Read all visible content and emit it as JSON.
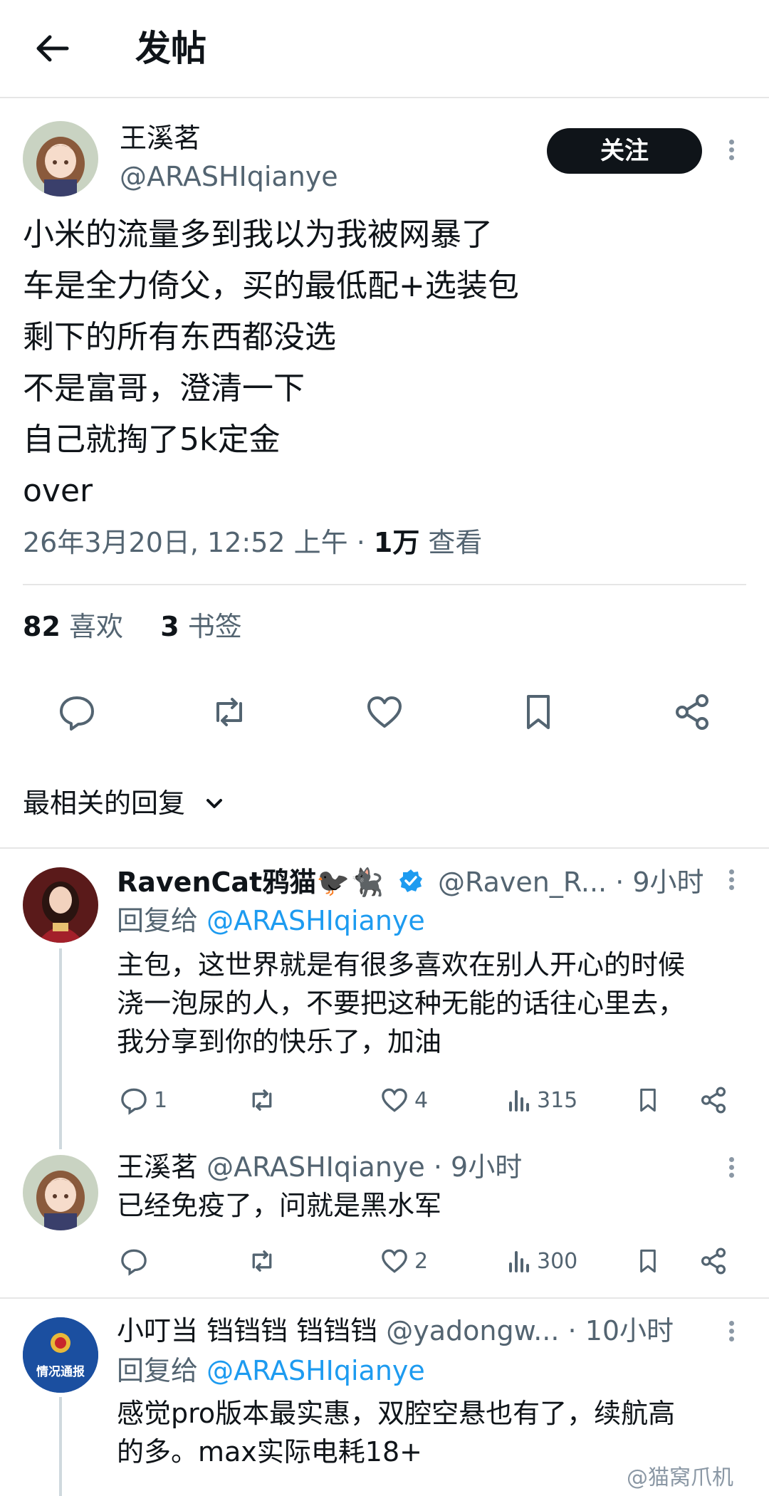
{
  "header": {
    "title": "发帖"
  },
  "post": {
    "author_name": "王溪茗",
    "author_handle": "@ARASHIqianye",
    "follow_label": "关注",
    "lines": [
      "小米的流量多到我以为我被网暴了",
      "车是全力倚父，买的最低配+选装包",
      "剩下的所有东西都没选",
      "不是富哥，澄清一下",
      "自己就掏了5k定金",
      "over"
    ],
    "timestamp": "26年3月20日, 12:52 上午 · ",
    "views_count": "1万",
    "views_label": " 查看",
    "likes_count": "82",
    "likes_label": "喜欢",
    "bookmarks_count": "3",
    "bookmarks_label": "书签"
  },
  "sort": {
    "label": "最相关的回复"
  },
  "replies": [
    {
      "name": "RavenCat鸦猫🐦‍⬛🐈‍⬛",
      "handle": "@Raven_R...",
      "time": "· 9小时",
      "reply_to_label": "回复给",
      "reply_to": "@ARASHIqianye",
      "lines": [
        "主包，这世界就是有很多喜欢在别人开心的时候",
        "浇一泡尿的人，不要把这种无能的话往心里去，",
        "我分享到你的快乐了，加油"
      ],
      "replies_count": "1",
      "retweets_count": "",
      "likes_count": "4",
      "views_count": "315"
    },
    {
      "name": "王溪茗",
      "handle": "@ARASHIqianye",
      "time": "· 9小时",
      "lines": [
        "已经免疫了，问就是黑水军"
      ],
      "replies_count": "",
      "retweets_count": "",
      "likes_count": "2",
      "views_count": "300"
    },
    {
      "name": "小叮当 铛铛铛 铛铛铛",
      "handle": "@yadongw...",
      "time": "· 10小时",
      "avatar_text": "情况通报",
      "reply_to_label": "回复给",
      "reply_to": "@ARASHIqianye",
      "lines": [
        "感觉pro版本最实惠，双腔空悬也有了，续航高",
        "的多。max实际电耗18+"
      ]
    }
  ],
  "watermark": "@猫窝爪机",
  "icons": [
    "back-arrow-icon",
    "kebab-icon",
    "reply-icon",
    "retweet-icon",
    "like-icon",
    "bookmark-icon",
    "share-icon",
    "chevron-down-icon",
    "verified-icon",
    "views-icon"
  ],
  "colors": {
    "accent": "#1d9bf0",
    "text": "#0f1419",
    "muted": "#536471",
    "follow_bg": "#0f1419"
  }
}
